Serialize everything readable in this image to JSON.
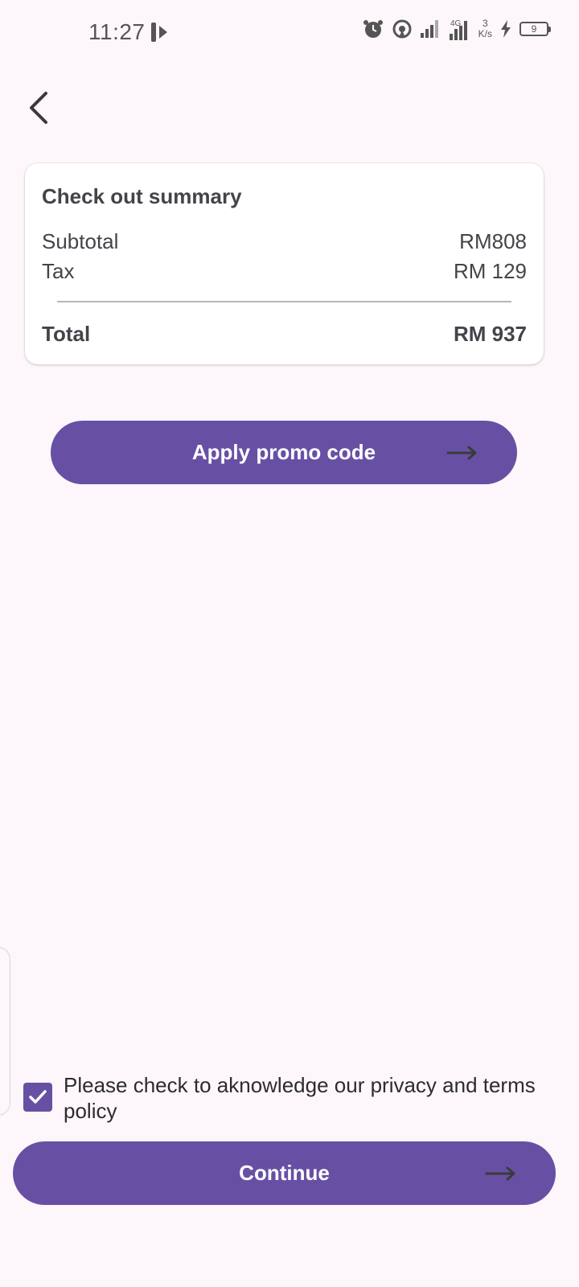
{
  "status_bar": {
    "time": "11:27",
    "net_speed_value": "3",
    "net_speed_unit": "K/s",
    "network_type": "4G",
    "battery_level": "9"
  },
  "summary": {
    "title": "Check out summary",
    "subtotal_label": "Subtotal",
    "subtotal_value": "RM808",
    "tax_label": "Tax",
    "tax_value": "RM 129",
    "total_label": "Total",
    "total_value": "RM 937"
  },
  "promo_button_label": "Apply promo code",
  "policy": {
    "checked": true,
    "text": "Please check to aknowledge our privacy and terms policy"
  },
  "continue_button_label": "Continue",
  "colors": {
    "accent": "#6750a4",
    "background": "#fdf7fc",
    "card": "#ffffff"
  },
  "icons": [
    "back-arrow-icon",
    "arrow-right-icon",
    "checkmark-icon",
    "alarm-icon",
    "hotspot-icon",
    "signal-icon",
    "battery-icon",
    "charging-icon"
  ]
}
